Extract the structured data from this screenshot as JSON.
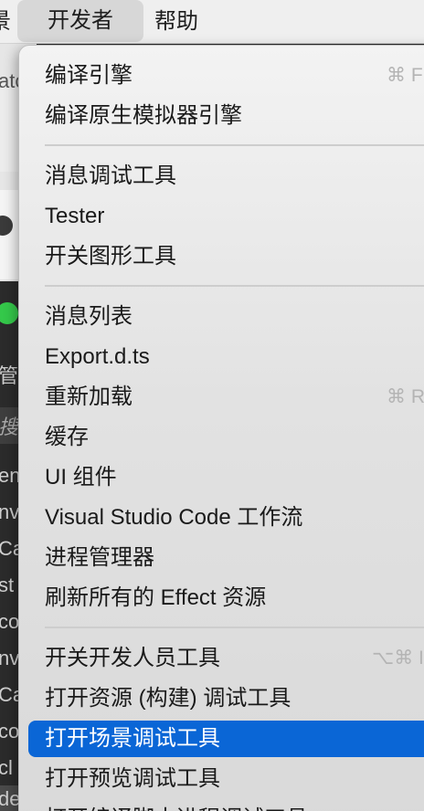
{
  "menubar": {
    "partial_left": "景",
    "developer": "开发者",
    "help": "帮助"
  },
  "background": {
    "texts": [
      "atc",
      "管",
      "搜",
      "en",
      "nv",
      "Ca",
      "st",
      "co",
      "nv",
      "Ca",
      "co",
      "cl",
      "de"
    ]
  },
  "menu": {
    "items": [
      {
        "label": "编译引擎",
        "shortcut": "⌘ F"
      },
      {
        "label": "编译原生模拟器引擎",
        "shortcut": ""
      },
      {
        "label": "消息调试工具",
        "shortcut": ""
      },
      {
        "label": "Tester",
        "shortcut": ""
      },
      {
        "label": "开关图形工具",
        "shortcut": ""
      },
      {
        "label": "消息列表",
        "shortcut": ""
      },
      {
        "label": "Export.d.ts",
        "shortcut": ""
      },
      {
        "label": "重新加载",
        "shortcut": "⌘ R"
      },
      {
        "label": "缓存",
        "shortcut": ""
      },
      {
        "label": "UI 组件",
        "shortcut": ""
      },
      {
        "label": "Visual Studio Code 工作流",
        "shortcut": ""
      },
      {
        "label": "进程管理器",
        "shortcut": ""
      },
      {
        "label": "刷新所有的 Effect 资源",
        "shortcut": ""
      },
      {
        "label": "开关开发人员工具",
        "shortcut": "⌥⌘ I"
      },
      {
        "label": "打开资源 (构建) 调试工具",
        "shortcut": ""
      },
      {
        "label": "打开场景调试工具",
        "shortcut": ""
      },
      {
        "label": "打开预览调试工具",
        "shortcut": ""
      },
      {
        "label": "打开编译脚本进程调试工具",
        "shortcut": ""
      }
    ]
  },
  "colors": {
    "selection": "#0a66d6",
    "traffic_green": "#34c84a"
  }
}
